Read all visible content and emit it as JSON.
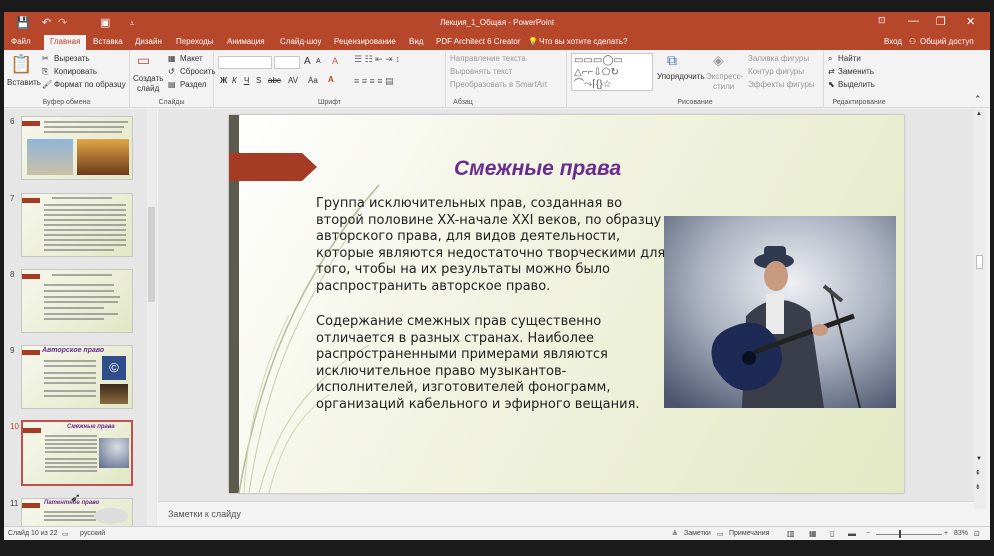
{
  "window": {
    "title": "Лекция_1_Общая - PowerPoint",
    "controls": {
      "ribbon_display": "⊡",
      "minimize": "—",
      "maximize": "❐",
      "close": "✕"
    }
  },
  "quick_access": {
    "save": "💾",
    "undo": "↶",
    "redo": "↷",
    "present": "▣",
    "customize": "⩡"
  },
  "menu": {
    "tabs": [
      "Файл",
      "Главная",
      "Вставка",
      "Дизайн",
      "Переходы",
      "Анимация",
      "Слайд-шоу",
      "Рецензирование",
      "Вид",
      "PDF Architect 6 Creator"
    ],
    "active": "Главная",
    "tell_me": "Что вы хотите сделать?",
    "signin": "Вход",
    "share": "Общий доступ"
  },
  "ribbon": {
    "clipboard": {
      "paste": "Вставить",
      "cut": "Вырезать",
      "copy": "Копировать",
      "format_painter": "Формат по образцу",
      "label": "Буфер обмена"
    },
    "slides": {
      "new_slide_1": "Создать",
      "new_slide_2": "слайд",
      "layout": "Макет",
      "reset": "Сбросить",
      "section": "Раздел",
      "label": "Слайды"
    },
    "font": {
      "label": "Шрифт",
      "bold": "Ж",
      "italic": "К",
      "underline": "Ч",
      "strike": "S",
      "abc": "abc",
      "av": "AV",
      "aa": "Aa",
      "grow": "A",
      "shrink": "A",
      "clear": "A"
    },
    "paragraph": {
      "text_direction": "Направление текста",
      "align_text": "Выровнять текст",
      "smartart": "Преобразовать в SmartArt",
      "label": "Абзац"
    },
    "drawing": {
      "arrange": "Упорядочить",
      "quick_styles_1": "Экспресс-",
      "quick_styles_2": "стили",
      "fill": "Заливка фигуры",
      "outline": "Контур фигуры",
      "effects": "Эффекты фигуры",
      "label": "Рисование"
    },
    "editing": {
      "find": "Найти",
      "replace": "Заменить",
      "select": "Выделить",
      "label": "Редактирование"
    }
  },
  "thumbnails": [
    {
      "num": "6",
      "title": ""
    },
    {
      "num": "7",
      "title": "Методы использования…"
    },
    {
      "num": "8",
      "title": "Виды интеллектуальной собственности"
    },
    {
      "num": "9",
      "title": "Авторское право"
    },
    {
      "num": "10",
      "title": "Смежные права"
    },
    {
      "num": "11",
      "title": "Патентное право"
    }
  ],
  "slide": {
    "title": "Смежные права",
    "paragraph1": "Группа исключительных прав, созданная во второй половине XX-начале XXI веков, по образцу авторского права, для видов деятельности, которые являются недостаточно творческими для того, чтобы на их результаты можно было распространить авторское право.",
    "paragraph2": "Содержание смежных прав существенно отличается в разных странах. Наиболее распространенными примерами являются исключительное право музыкантов-исполнителей, изготовителей фонограмм, организаций кабельного и эфирного вещания.",
    "accent_color": "#a63b24",
    "title_color": "#6a2c91"
  },
  "notes": {
    "placeholder": "Заметки к слайду"
  },
  "status": {
    "slide_of": "Слайд 10 из 22",
    "language": "русский",
    "notes_btn": "Заметки",
    "comments_btn": "Примечания",
    "zoom": "83%"
  }
}
